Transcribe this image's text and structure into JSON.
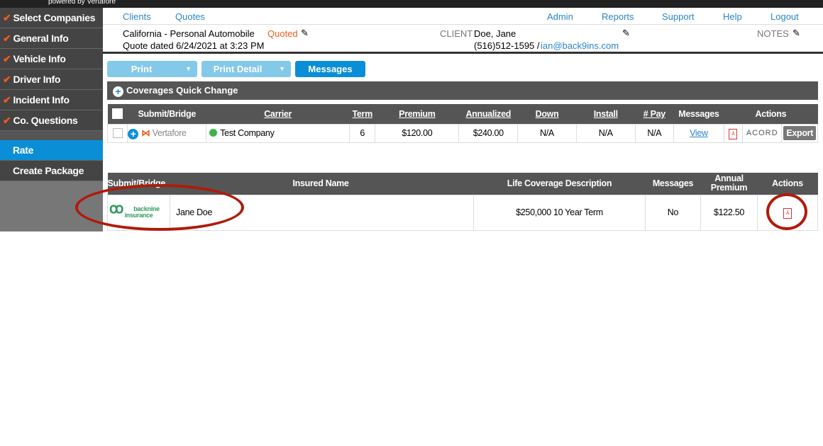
{
  "topbar": {
    "powered": "powered by Vertafore"
  },
  "sidebar": {
    "items": [
      {
        "label": "Select Companies",
        "checked": true
      },
      {
        "label": "General Info",
        "checked": true
      },
      {
        "label": "Vehicle Info",
        "checked": true
      },
      {
        "label": "Driver Info",
        "checked": true
      },
      {
        "label": "Incident Info",
        "checked": true
      },
      {
        "label": "Co. Questions",
        "checked": true
      }
    ],
    "rate": "Rate",
    "create_package": "Create Package"
  },
  "nav": {
    "clients": "Clients",
    "quotes": "Quotes",
    "admin": "Admin",
    "reports": "Reports",
    "support": "Support",
    "help": "Help",
    "logout": "Logout"
  },
  "quote": {
    "title": "California - Personal Automobile",
    "status": "Quoted",
    "dated": "Quote dated 6/24/2021 at 3:23 PM",
    "client_label": "CLIENT",
    "client_name": "Doe, Jane",
    "phone": "(516)512-1595 /",
    "email": "ian@back9ins.com",
    "notes_label": "NOTES"
  },
  "buttons": {
    "print": "Print",
    "print_detail": "Print Detail",
    "messages": "Messages"
  },
  "quick_change": "Coverages Quick Change",
  "auto_table": {
    "headers": [
      "Submit/Bridge",
      "Carrier",
      "Term",
      "Premium",
      "Annualized",
      "Down",
      "Install",
      "# Pay",
      "Messages",
      "Actions"
    ],
    "row": {
      "bridge_logo": "Vertafore",
      "carrier": "Test Company",
      "term": "6",
      "premium": "$120.00",
      "annualized": "$240.00",
      "down": "N/A",
      "install": "N/A",
      "pay": "N/A",
      "messages": "View",
      "acord": "ACORD",
      "export": "Export"
    }
  },
  "life_table": {
    "headers": [
      "Submit/Bridge",
      "Insured Name",
      "Life Coverage Description",
      "Messages",
      "Annual Premium",
      "Actions"
    ],
    "row": {
      "logo": "backnine insurance",
      "insured": "Jane Doe",
      "description": "$250,000 10 Year Term",
      "messages": "No",
      "premium": "$122.50"
    }
  },
  "colors": {
    "accent": "#0a8fd6",
    "check": "#f25a1e",
    "annotation": "#b01a0a"
  }
}
